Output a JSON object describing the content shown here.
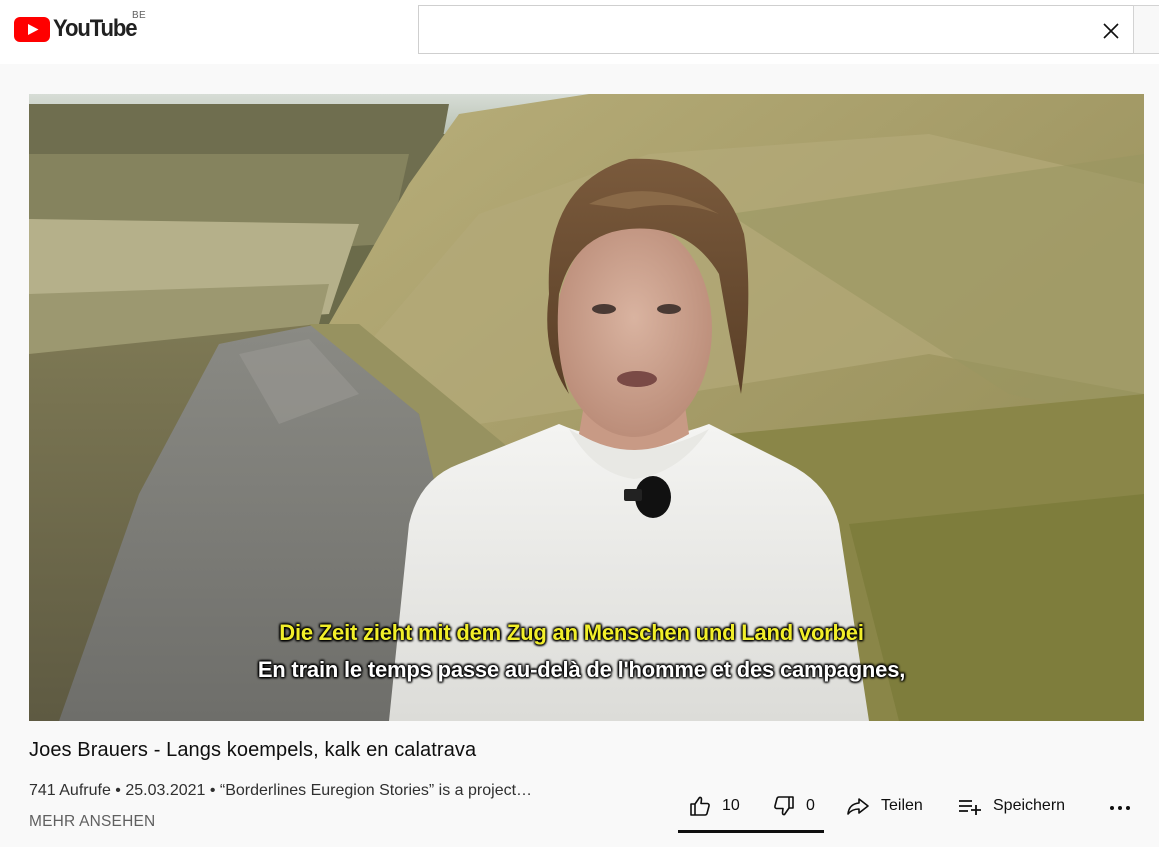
{
  "header": {
    "logo_text": "YouTube",
    "country_code": "BE",
    "search_value": "",
    "search_placeholder": ""
  },
  "player": {
    "subtitle_de": "Die Zeit zieht mit dem Zug an Menschen und Land vorbei",
    "subtitle_fr": "En train le temps passe au-delà de l'homme et des campagnes,"
  },
  "video": {
    "title": "Joes Brauers - Langs koempels, kalk en calatrava",
    "meta": "741 Aufrufe • 25.03.2021 • “Borderlines Euregion Stories” is a project…",
    "more_label": "MEHR ANSEHEN"
  },
  "actions": {
    "like_count": "10",
    "dislike_count": "0",
    "share_label": "Teilen",
    "save_label": "Speichern"
  },
  "colors": {
    "brand_red": "#ff0000",
    "subtitle_yellow": "#f2ef2a"
  },
  "icons": [
    "youtube-logo-icon",
    "close-icon",
    "thumbs-up-icon",
    "thumbs-down-icon",
    "share-icon",
    "save-playlist-icon",
    "more-icon"
  ]
}
